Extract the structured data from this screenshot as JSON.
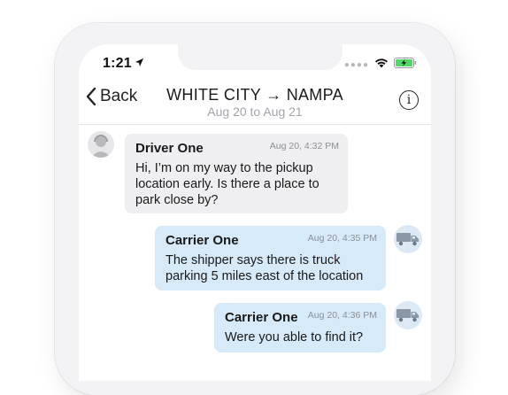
{
  "status_bar": {
    "time": "1:21",
    "location_icon": "location-arrow-icon",
    "signal": "dots",
    "wifi_icon": "wifi-icon",
    "battery_icon": "battery-charging-icon",
    "battery_color": "#4cd964"
  },
  "nav": {
    "back_label": "Back",
    "title": "WHITE CITY → NAMPA",
    "subtitle": "Aug 20 to Aug 21",
    "info_glyph": "i"
  },
  "messages": [
    {
      "sender": "Driver One",
      "timestamp": "Aug 20, 4:32 PM",
      "lines": [
        "Hi, I’m on my way to the pickup",
        "location early.  Is there a place to",
        "park close by?"
      ],
      "side": "left",
      "avatar": "driver-avatar"
    },
    {
      "sender": "Carrier One",
      "timestamp": "Aug 20, 4:35 PM",
      "lines": [
        "The shipper says there is truck",
        "parking 5 miles east of the location"
      ],
      "side": "right",
      "avatar": "truck-avatar"
    },
    {
      "sender": "Carrier One",
      "timestamp": "Aug 20, 4:36 PM",
      "lines": [
        "Were you able to find it?"
      ],
      "side": "right",
      "avatar": "truck-avatar"
    }
  ],
  "colors": {
    "driver_bubble": "#efeff1",
    "carrier_bubble": "#d6eaf9",
    "timestamp": "#8c9096"
  }
}
